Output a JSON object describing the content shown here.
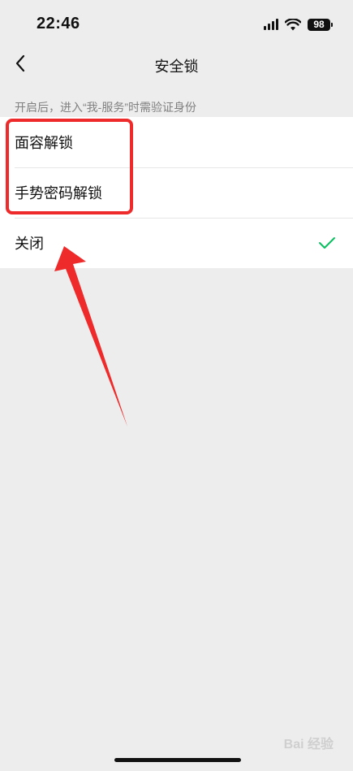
{
  "status_bar": {
    "time": "22:46",
    "battery": "98"
  },
  "nav": {
    "title": "安全锁",
    "back_icon": "chevron-left-icon"
  },
  "hint": "开启后，进入“我-服务”时需验证身份",
  "options": [
    {
      "label": "面容解锁",
      "selected": false
    },
    {
      "label": "手势密码解锁",
      "selected": false
    },
    {
      "label": "关闭",
      "selected": true
    }
  ],
  "colors": {
    "accent": "#07c160",
    "annotation": "#ee2a2a",
    "background": "#ededed"
  },
  "watermark": "Bai 经验"
}
